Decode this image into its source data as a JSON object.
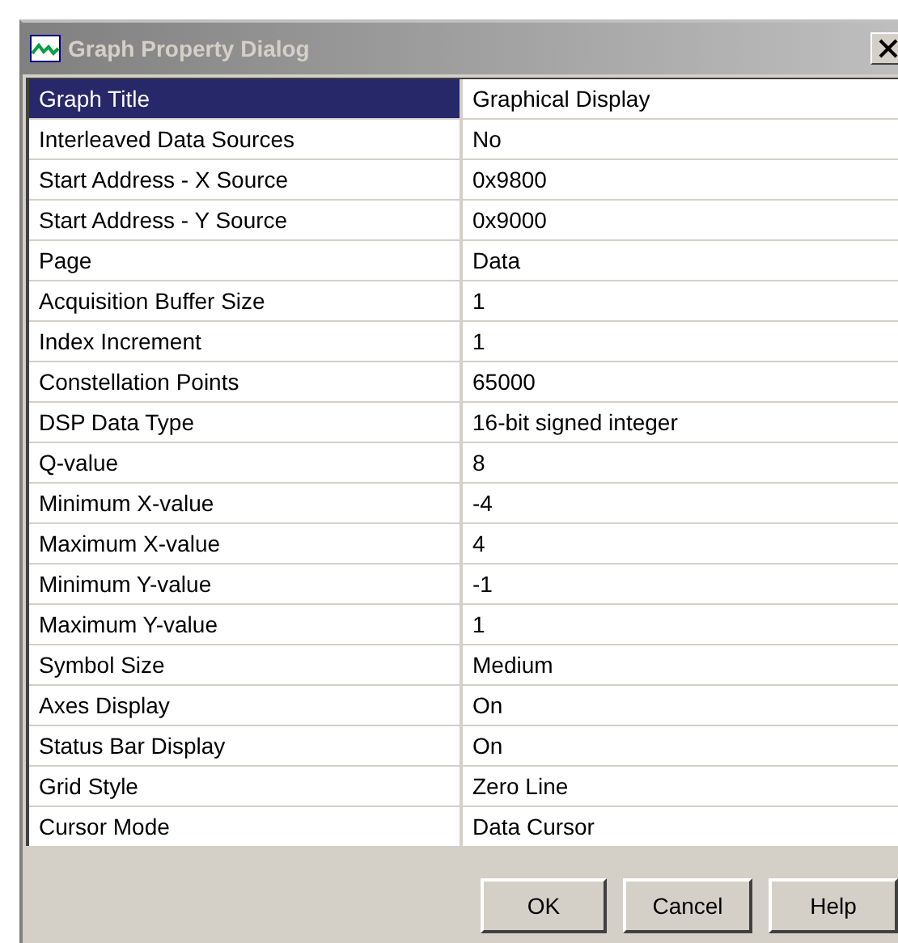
{
  "window": {
    "title": "Graph Property Dialog"
  },
  "properties": [
    {
      "name": "Graph Title",
      "value": "Graphical Display",
      "selected": true
    },
    {
      "name": "Interleaved Data Sources",
      "value": "No",
      "selected": false
    },
    {
      "name": "Start Address - X Source",
      "value": "0x9800",
      "selected": false
    },
    {
      "name": "Start Address - Y Source",
      "value": "0x9000",
      "selected": false
    },
    {
      "name": "Page",
      "value": "Data",
      "selected": false
    },
    {
      "name": "Acquisition Buffer Size",
      "value": "1",
      "selected": false
    },
    {
      "name": "Index Increment",
      "value": "1",
      "selected": false
    },
    {
      "name": "Constellation Points",
      "value": "65000",
      "selected": false
    },
    {
      "name": "DSP Data Type",
      "value": "16-bit signed integer",
      "selected": false
    },
    {
      "name": "Q-value",
      "value": "8",
      "selected": false
    },
    {
      "name": "Minimum X-value",
      "value": "-4",
      "selected": false
    },
    {
      "name": "Maximum X-value",
      "value": "4",
      "selected": false
    },
    {
      "name": "Minimum Y-value",
      "value": "-1",
      "selected": false
    },
    {
      "name": "Maximum Y-value",
      "value": "1",
      "selected": false
    },
    {
      "name": "Symbol Size",
      "value": "Medium",
      "selected": false
    },
    {
      "name": "Axes Display",
      "value": "On",
      "selected": false
    },
    {
      "name": "Status Bar Display",
      "value": "On",
      "selected": false
    },
    {
      "name": "Grid Style",
      "value": "Zero Line",
      "selected": false
    },
    {
      "name": "Cursor Mode",
      "value": "Data Cursor",
      "selected": false
    }
  ],
  "buttons": [
    "OK",
    "Cancel",
    "Help"
  ]
}
